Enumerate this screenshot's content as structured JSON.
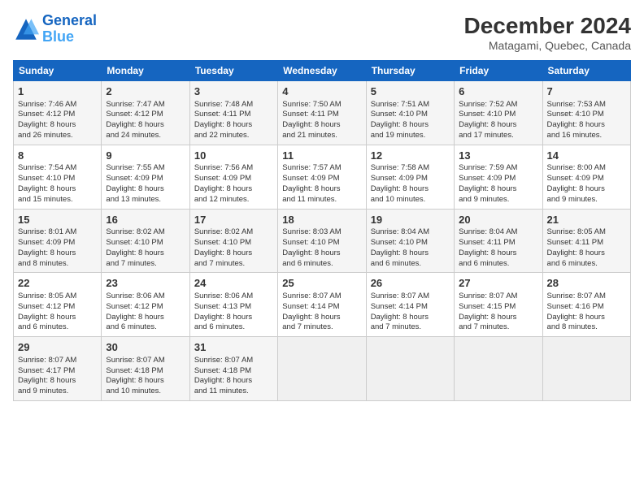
{
  "logo": {
    "line1": "General",
    "line2": "Blue"
  },
  "title": "December 2024",
  "subtitle": "Matagami, Quebec, Canada",
  "days_of_week": [
    "Sunday",
    "Monday",
    "Tuesday",
    "Wednesday",
    "Thursday",
    "Friday",
    "Saturday"
  ],
  "weeks": [
    [
      {
        "day": "1",
        "info": "Sunrise: 7:46 AM\nSunset: 4:12 PM\nDaylight: 8 hours\nand 26 minutes."
      },
      {
        "day": "2",
        "info": "Sunrise: 7:47 AM\nSunset: 4:12 PM\nDaylight: 8 hours\nand 24 minutes."
      },
      {
        "day": "3",
        "info": "Sunrise: 7:48 AM\nSunset: 4:11 PM\nDaylight: 8 hours\nand 22 minutes."
      },
      {
        "day": "4",
        "info": "Sunrise: 7:50 AM\nSunset: 4:11 PM\nDaylight: 8 hours\nand 21 minutes."
      },
      {
        "day": "5",
        "info": "Sunrise: 7:51 AM\nSunset: 4:10 PM\nDaylight: 8 hours\nand 19 minutes."
      },
      {
        "day": "6",
        "info": "Sunrise: 7:52 AM\nSunset: 4:10 PM\nDaylight: 8 hours\nand 17 minutes."
      },
      {
        "day": "7",
        "info": "Sunrise: 7:53 AM\nSunset: 4:10 PM\nDaylight: 8 hours\nand 16 minutes."
      }
    ],
    [
      {
        "day": "8",
        "info": "Sunrise: 7:54 AM\nSunset: 4:10 PM\nDaylight: 8 hours\nand 15 minutes."
      },
      {
        "day": "9",
        "info": "Sunrise: 7:55 AM\nSunset: 4:09 PM\nDaylight: 8 hours\nand 13 minutes."
      },
      {
        "day": "10",
        "info": "Sunrise: 7:56 AM\nSunset: 4:09 PM\nDaylight: 8 hours\nand 12 minutes."
      },
      {
        "day": "11",
        "info": "Sunrise: 7:57 AM\nSunset: 4:09 PM\nDaylight: 8 hours\nand 11 minutes."
      },
      {
        "day": "12",
        "info": "Sunrise: 7:58 AM\nSunset: 4:09 PM\nDaylight: 8 hours\nand 10 minutes."
      },
      {
        "day": "13",
        "info": "Sunrise: 7:59 AM\nSunset: 4:09 PM\nDaylight: 8 hours\nand 9 minutes."
      },
      {
        "day": "14",
        "info": "Sunrise: 8:00 AM\nSunset: 4:09 PM\nDaylight: 8 hours\nand 9 minutes."
      }
    ],
    [
      {
        "day": "15",
        "info": "Sunrise: 8:01 AM\nSunset: 4:09 PM\nDaylight: 8 hours\nand 8 minutes."
      },
      {
        "day": "16",
        "info": "Sunrise: 8:02 AM\nSunset: 4:10 PM\nDaylight: 8 hours\nand 7 minutes."
      },
      {
        "day": "17",
        "info": "Sunrise: 8:02 AM\nSunset: 4:10 PM\nDaylight: 8 hours\nand 7 minutes."
      },
      {
        "day": "18",
        "info": "Sunrise: 8:03 AM\nSunset: 4:10 PM\nDaylight: 8 hours\nand 6 minutes."
      },
      {
        "day": "19",
        "info": "Sunrise: 8:04 AM\nSunset: 4:10 PM\nDaylight: 8 hours\nand 6 minutes."
      },
      {
        "day": "20",
        "info": "Sunrise: 8:04 AM\nSunset: 4:11 PM\nDaylight: 8 hours\nand 6 minutes."
      },
      {
        "day": "21",
        "info": "Sunrise: 8:05 AM\nSunset: 4:11 PM\nDaylight: 8 hours\nand 6 minutes."
      }
    ],
    [
      {
        "day": "22",
        "info": "Sunrise: 8:05 AM\nSunset: 4:12 PM\nDaylight: 8 hours\nand 6 minutes."
      },
      {
        "day": "23",
        "info": "Sunrise: 8:06 AM\nSunset: 4:12 PM\nDaylight: 8 hours\nand 6 minutes."
      },
      {
        "day": "24",
        "info": "Sunrise: 8:06 AM\nSunset: 4:13 PM\nDaylight: 8 hours\nand 6 minutes."
      },
      {
        "day": "25",
        "info": "Sunrise: 8:07 AM\nSunset: 4:14 PM\nDaylight: 8 hours\nand 7 minutes."
      },
      {
        "day": "26",
        "info": "Sunrise: 8:07 AM\nSunset: 4:14 PM\nDaylight: 8 hours\nand 7 minutes."
      },
      {
        "day": "27",
        "info": "Sunrise: 8:07 AM\nSunset: 4:15 PM\nDaylight: 8 hours\nand 7 minutes."
      },
      {
        "day": "28",
        "info": "Sunrise: 8:07 AM\nSunset: 4:16 PM\nDaylight: 8 hours\nand 8 minutes."
      }
    ],
    [
      {
        "day": "29",
        "info": "Sunrise: 8:07 AM\nSunset: 4:17 PM\nDaylight: 8 hours\nand 9 minutes."
      },
      {
        "day": "30",
        "info": "Sunrise: 8:07 AM\nSunset: 4:18 PM\nDaylight: 8 hours\nand 10 minutes."
      },
      {
        "day": "31",
        "info": "Sunrise: 8:07 AM\nSunset: 4:18 PM\nDaylight: 8 hours\nand 11 minutes."
      },
      null,
      null,
      null,
      null
    ]
  ]
}
